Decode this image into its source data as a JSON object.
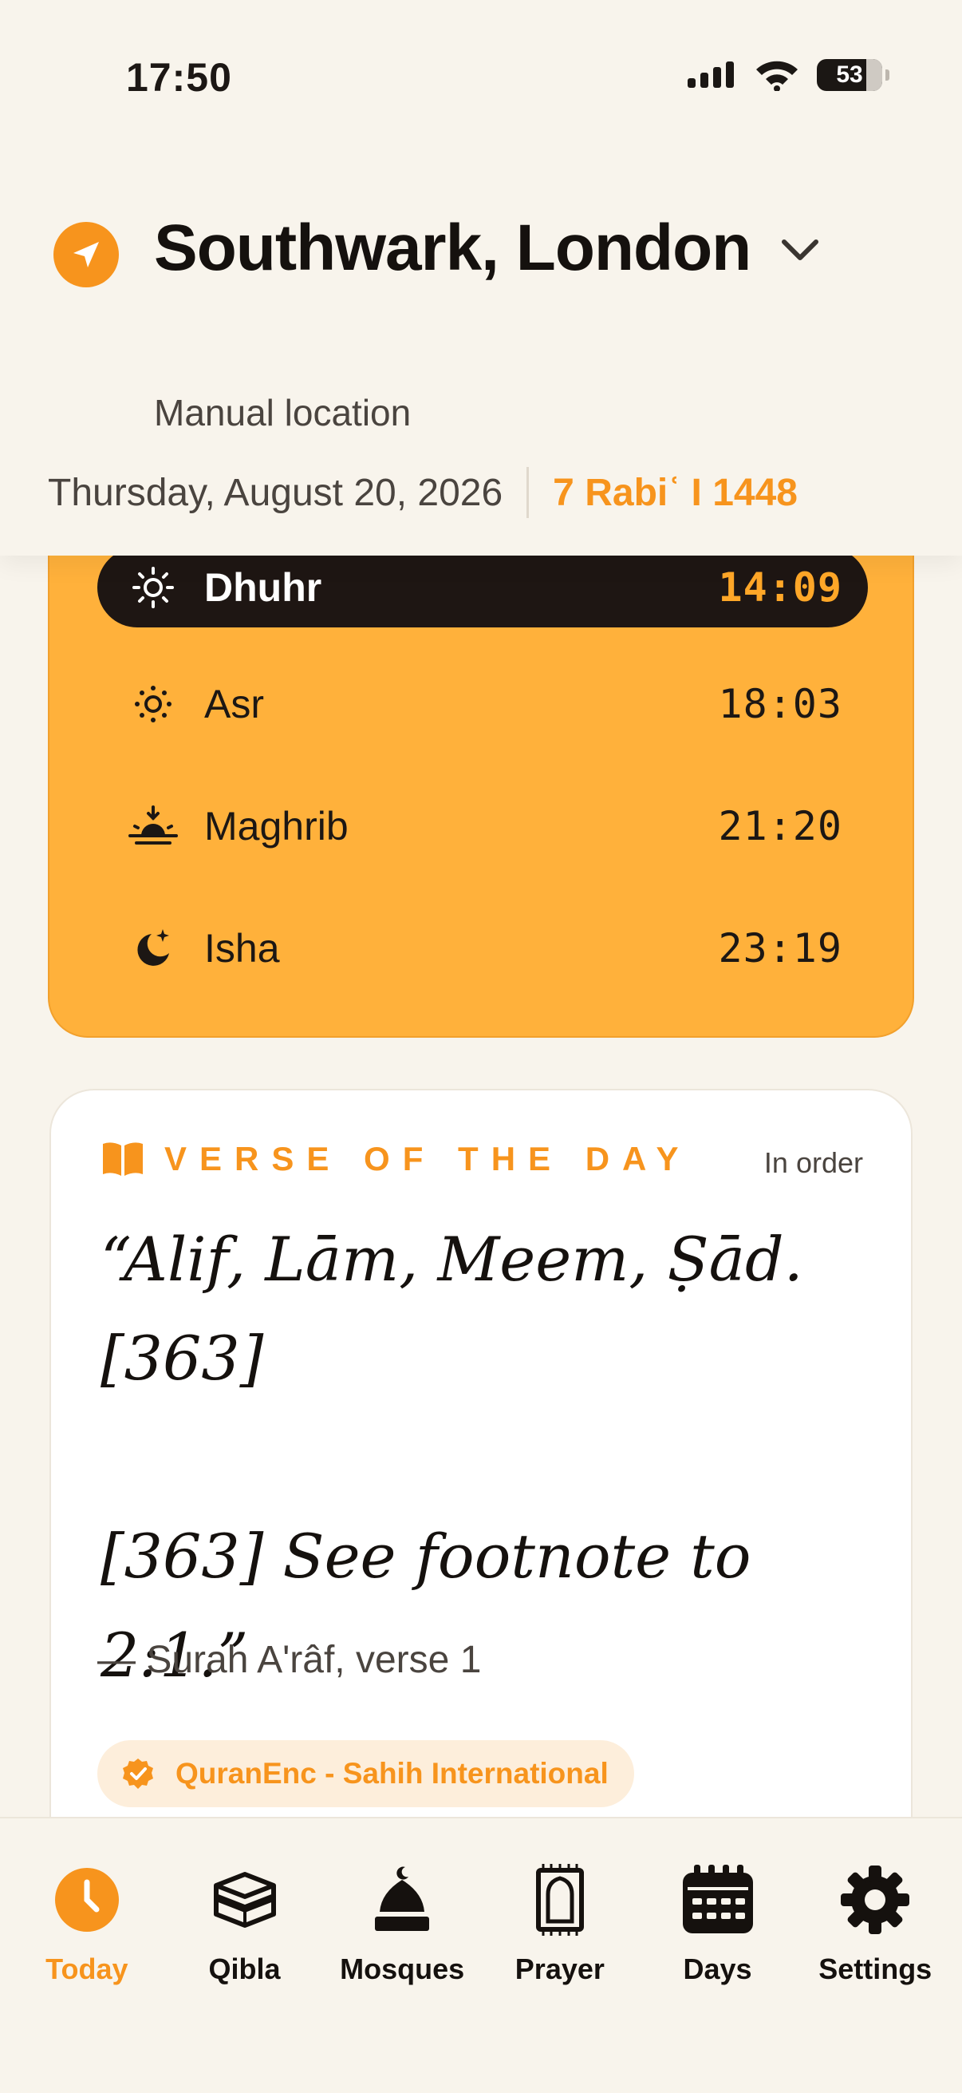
{
  "status_bar": {
    "time": "17:50",
    "battery": "53"
  },
  "header": {
    "location": "Southwark, London",
    "location_mode": "Manual location",
    "date_gregorian": "Thursday, August 20, 2026",
    "date_hijri": "7 Rabiʿ I 1448"
  },
  "prayers": [
    {
      "name": "Dhuhr",
      "time": "14:09",
      "icon": "sun-icon",
      "active": true
    },
    {
      "name": "Asr",
      "time": "18:03",
      "icon": "sun-small-icon",
      "active": false
    },
    {
      "name": "Maghrib",
      "time": "21:20",
      "icon": "sunset-icon",
      "active": false
    },
    {
      "name": "Isha",
      "time": "23:19",
      "icon": "moon-stars-icon",
      "active": false
    }
  ],
  "verse": {
    "label": "VERSE OF THE DAY",
    "order": "In order",
    "text": "“Alif, Lām, Meem, Ṣād. [363]\n\n[363] See footnote to 2:1.”",
    "reference": "— Surah A'râf, verse 1",
    "source": "QuranEnc - Sahih International"
  },
  "tabs": [
    {
      "label": "Today",
      "icon": "clock-icon",
      "active": true
    },
    {
      "label": "Qibla",
      "icon": "kaaba-icon",
      "active": false
    },
    {
      "label": "Mosques",
      "icon": "mosque-icon",
      "active": false
    },
    {
      "label": "Prayer",
      "icon": "prayer-mat-icon",
      "active": false
    },
    {
      "label": "Days",
      "icon": "calendar-icon",
      "active": false
    },
    {
      "label": "Settings",
      "icon": "gear-icon",
      "active": false
    }
  ],
  "colors": {
    "accent": "#f7941d",
    "card": "#ffb13b",
    "active_row": "#1e1613",
    "background": "#f8f4ec"
  }
}
